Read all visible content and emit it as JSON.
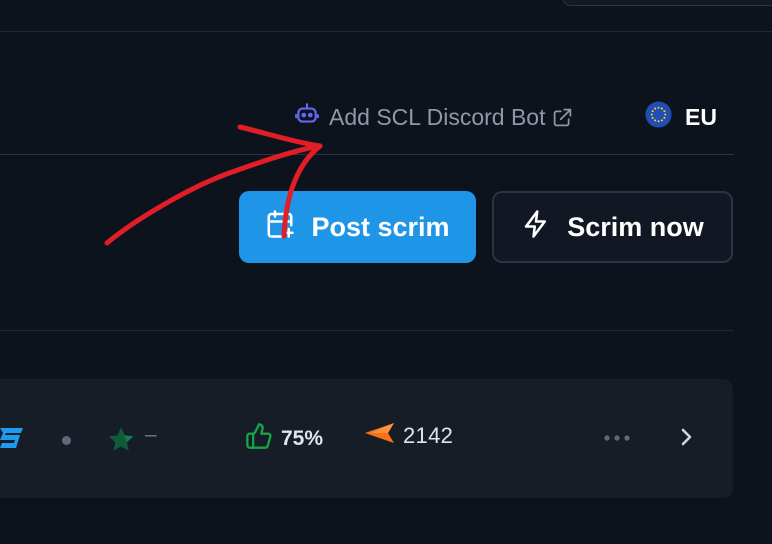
{
  "header": {
    "discord_bot_label": "Add SCL Discord Bot",
    "region_label": "EU"
  },
  "actions": {
    "post_scrim_label": "Post scrim",
    "scrim_now_label": "Scrim now"
  },
  "scrim_row": {
    "rank_value": "–",
    "rating_value": "75%",
    "elo_value": "2142"
  },
  "colors": {
    "accent": "#1f95e8",
    "annotation": "#e11d27",
    "thumb": "#16a34a",
    "elo": "#f97316"
  },
  "icons": {
    "discord_bot": "robot-icon",
    "external_link": "external-link-icon",
    "region_flag": "eu-flag-icon",
    "post_scrim": "calendar-plus-icon",
    "scrim_now": "lightning-icon",
    "rank": "star-icon",
    "rating": "thumbs-up-icon",
    "elo": "elo-chevron-icon",
    "more": "more-dots-icon",
    "open_row": "chevron-right-icon"
  }
}
